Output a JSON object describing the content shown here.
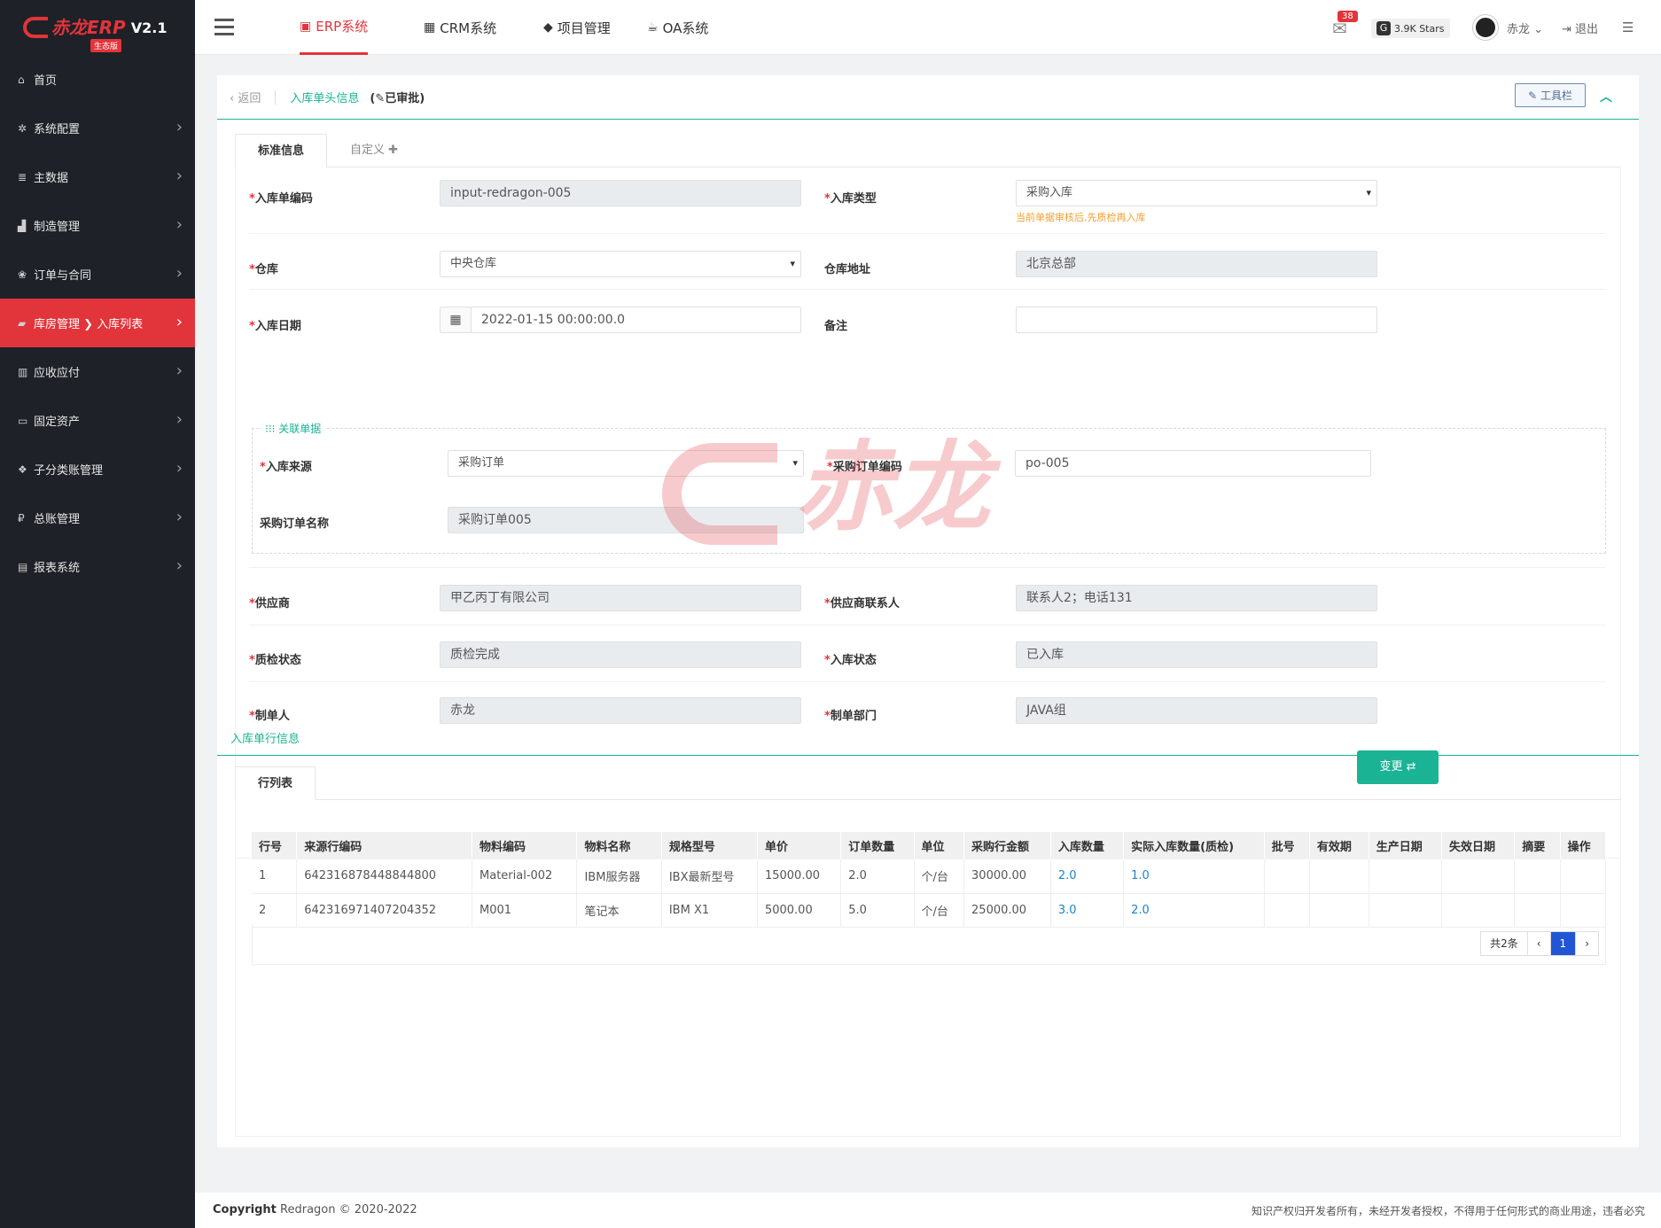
{
  "app": {
    "brand": "赤龙ERP",
    "version": "V2.1",
    "tag": "生态版"
  },
  "sidebar": {
    "items": [
      {
        "icon": "home-icon",
        "glyph": "⌂",
        "label": "首页"
      },
      {
        "icon": "gear-icon",
        "glyph": "✲",
        "label": "系统配置"
      },
      {
        "icon": "database-icon",
        "glyph": "≣",
        "label": "主数据"
      },
      {
        "icon": "chart-icon",
        "glyph": "▟",
        "label": "制造管理"
      },
      {
        "icon": "handshake-icon",
        "glyph": "❀",
        "label": "订单与合同"
      },
      {
        "icon": "truck-icon",
        "glyph": "▰",
        "label": "库房管理 ❯ 入库列表"
      },
      {
        "icon": "bank-icon",
        "glyph": "▥",
        "label": "应收应付"
      },
      {
        "icon": "monitor-icon",
        "glyph": "▭",
        "label": "固定资产"
      },
      {
        "icon": "sitemap-icon",
        "glyph": "❖",
        "label": "子分类账管理"
      },
      {
        "icon": "ruble-icon",
        "glyph": "₽",
        "label": "总账管理"
      },
      {
        "icon": "book-icon",
        "glyph": "▤",
        "label": "报表系统"
      }
    ]
  },
  "topbar": {
    "tabs": [
      {
        "icon": "erp-icon",
        "glyph": "▣",
        "label": "ERP系统"
      },
      {
        "icon": "truck-icon",
        "glyph": "▦",
        "label": "CRM系统"
      },
      {
        "icon": "cube-icon",
        "glyph": "◆",
        "label": "项目管理"
      },
      {
        "icon": "coffee-icon",
        "glyph": "☕",
        "label": "OA系统"
      }
    ],
    "mail_count": "38",
    "stars": "3.9K Stars",
    "username": "赤龙",
    "logout": "退出"
  },
  "panel": {
    "back": "返回",
    "title": "入库单头信息",
    "status": "(✎已审批)",
    "toolbar": "工具栏",
    "tabs": [
      "标准信息",
      "自定义 ✚"
    ]
  },
  "form": {
    "inbound_code": {
      "label": "入库单编码",
      "value": "input-redragon-005"
    },
    "inbound_type": {
      "label": "入库类型",
      "value": "采购入库",
      "hint": "当前单据审核后,先质检再入库"
    },
    "warehouse": {
      "label": "仓库",
      "value": "中央仓库"
    },
    "warehouse_addr": {
      "label": "仓库地址",
      "value": "北京总部"
    },
    "inbound_date": {
      "label": "入库日期",
      "value": "2022-01-15 00:00:00.0"
    },
    "remark": {
      "label": "备注",
      "value": ""
    },
    "related": {
      "legend": "关联单据",
      "source": {
        "label": "入库来源",
        "value": "采购订单"
      },
      "po_code": {
        "label": "采购订单编码",
        "value": "po-005"
      },
      "po_name": {
        "label": "采购订单名称",
        "value": "采购订单005"
      }
    },
    "supplier": {
      "label": "供应商",
      "value": "甲乙丙丁有限公司"
    },
    "supplier_contact": {
      "label": "供应商联系人",
      "value": "联系人2；电话131"
    },
    "qc_status": {
      "label": "质检状态",
      "value": "质检完成"
    },
    "inbound_status": {
      "label": "入库状态",
      "value": "已入库"
    },
    "creator": {
      "label": "制单人",
      "value": "赤龙"
    },
    "dept": {
      "label": "制单部门",
      "value": "JAVA组"
    },
    "change_btn": "变更 ⇄"
  },
  "lines": {
    "title": "入库单行信息",
    "tab": "行列表",
    "columns": [
      "行号",
      "来源行编码",
      "物料编码",
      "物料名称",
      "规格型号",
      "单价",
      "订单数量",
      "单位",
      "采购行金额",
      "入库数量",
      "实际入库数量(质检)",
      "批号",
      "有效期",
      "生产日期",
      "失效日期",
      "摘要",
      "操作"
    ],
    "rows": [
      [
        "1",
        "642316878448844800",
        "Material-002",
        "IBM服务器",
        "IBX最新型号",
        "15000.00",
        "2.0",
        "个/台",
        "30000.00",
        "2.0",
        "1.0",
        "",
        "",
        "",
        "",
        "",
        ""
      ],
      [
        "2",
        "642316971407204352",
        "M001",
        "笔记本",
        "IBM X1",
        "5000.00",
        "5.0",
        "个/台",
        "25000.00",
        "3.0",
        "2.0",
        "",
        "",
        "",
        "",
        "",
        ""
      ]
    ],
    "pager": {
      "total": "共2条",
      "prev": "‹",
      "page": "1",
      "next": "›"
    }
  },
  "footer": {
    "copyright": "Copyright",
    "text": " Redragon © 2020-2022",
    "notice": "知识产权归开发者所有，未经开发者授权，不得用于任何形式的商业用途，违者必究"
  },
  "colors": {
    "brand": "#e2343b",
    "accent": "#1ab394",
    "link": "#1c84c6"
  }
}
